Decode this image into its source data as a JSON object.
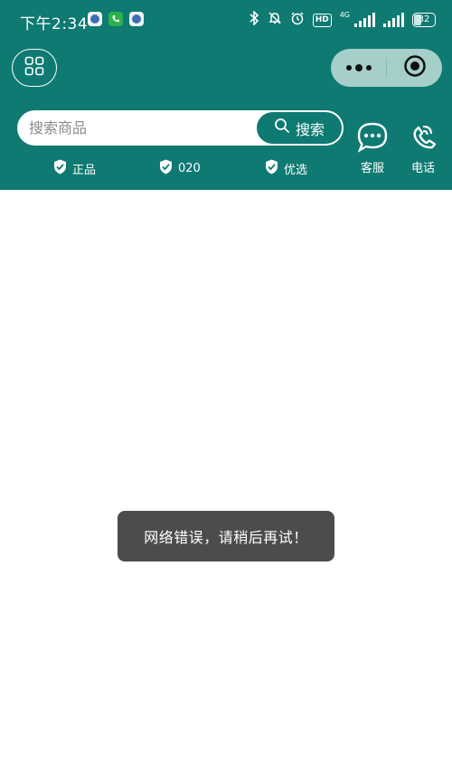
{
  "status_bar": {
    "time": "下午2:34",
    "network_type": "4G",
    "battery": "32",
    "hd_label": "HD"
  },
  "nav": {
    "menu_icon": "grid-icon",
    "more_icon": "more-dots-icon",
    "close_icon": "target-close-icon"
  },
  "search": {
    "placeholder": "搜索商品",
    "button_label": "搜索"
  },
  "badges": [
    {
      "label": "正品",
      "icon": "shield-check-icon"
    },
    {
      "label": "020",
      "icon": "shield-check-icon"
    },
    {
      "label": "优选",
      "icon": "shield-check-icon"
    }
  ],
  "actions": {
    "service_label": "客服",
    "phone_label": "电话"
  },
  "toast": {
    "message": "网络错误，请稍后再试！"
  },
  "colors": {
    "header_bg": "#0e7a72",
    "capsule_bg": "#a6cfca",
    "toast_bg": "#4c4c4c"
  }
}
